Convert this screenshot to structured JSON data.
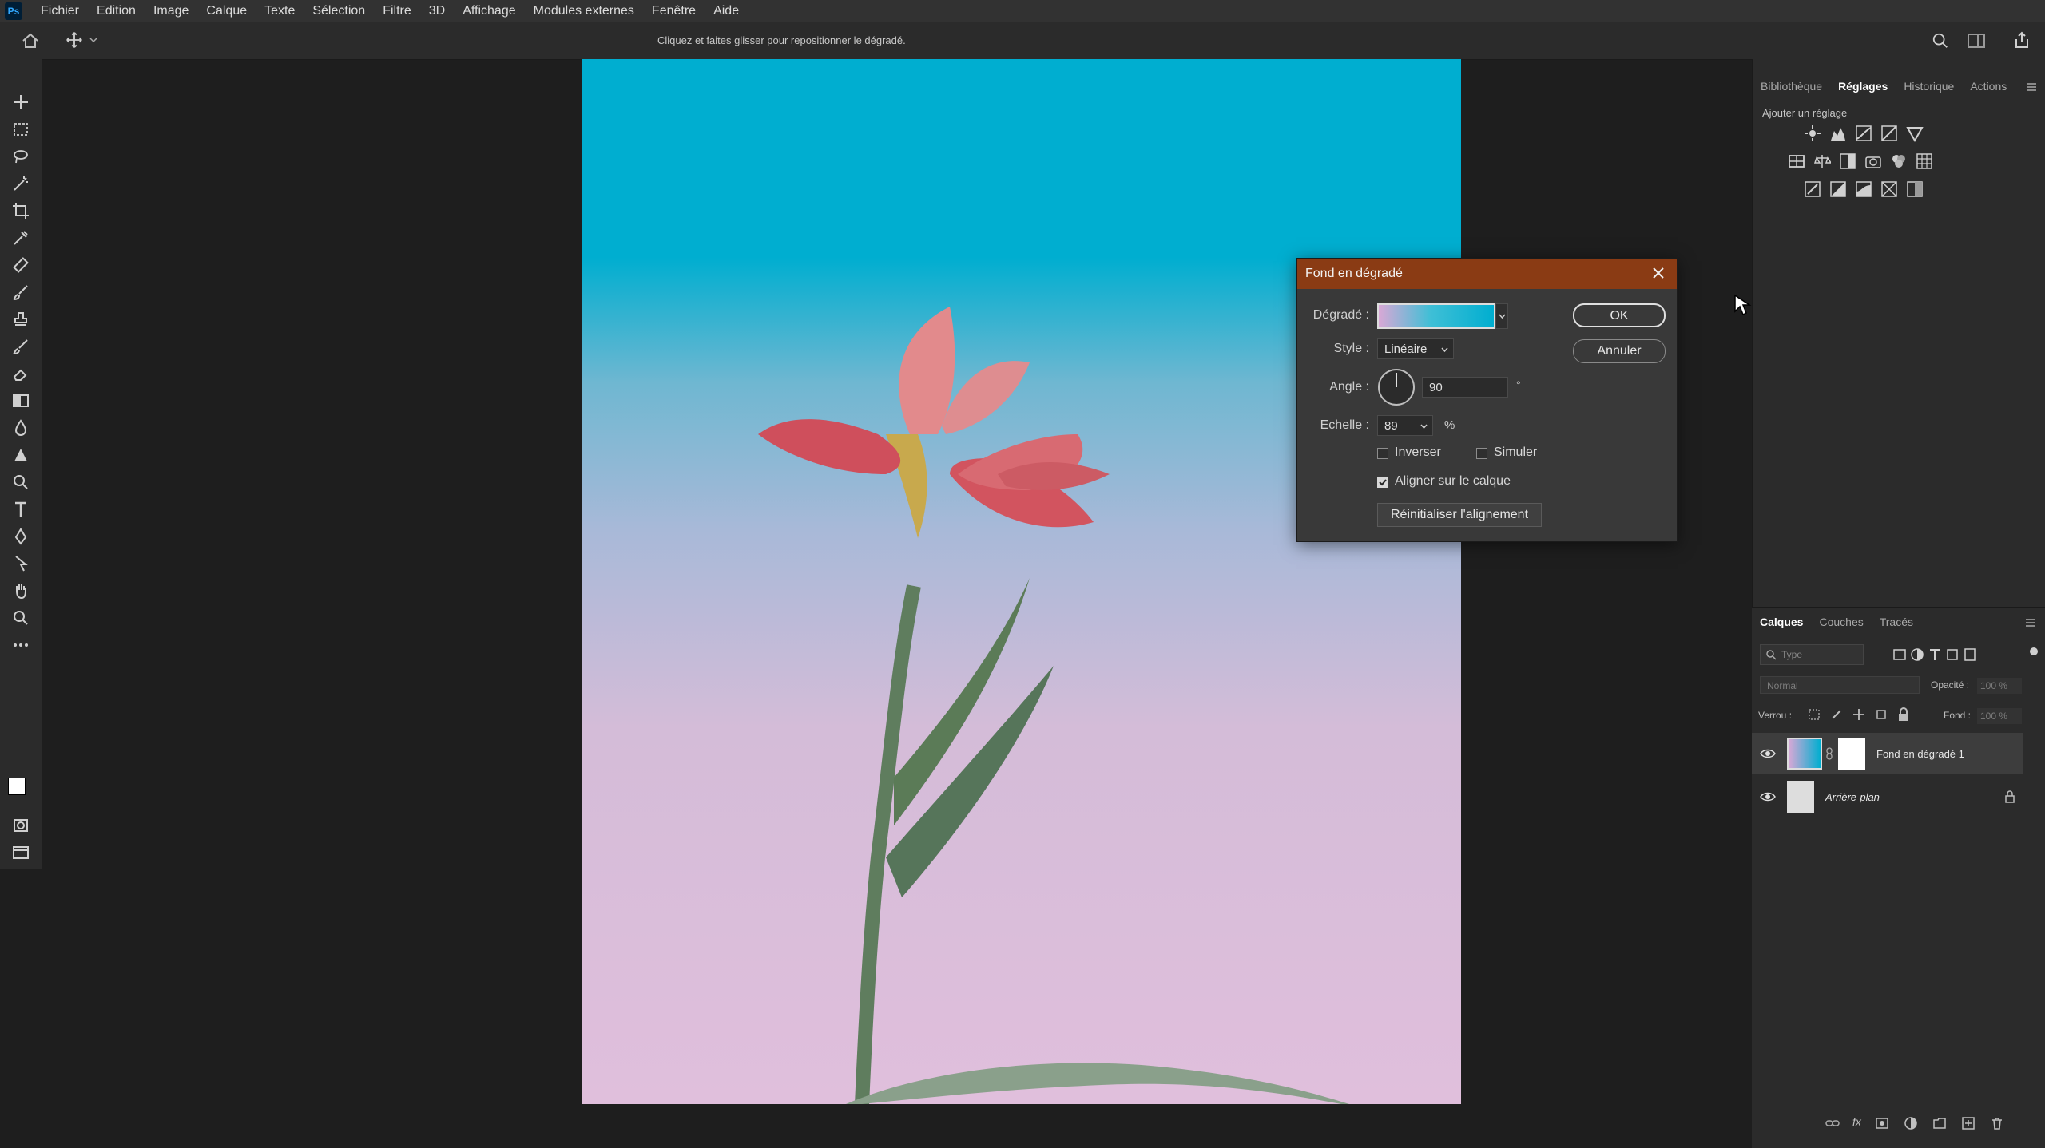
{
  "app": {
    "logo_text": "Ps"
  },
  "menu": [
    "Fichier",
    "Edition",
    "Image",
    "Calque",
    "Texte",
    "Sélection",
    "Filtre",
    "3D",
    "Affichage",
    "Modules externes",
    "Fenêtre",
    "Aide"
  ],
  "options_bar": {
    "hint": "Cliquez et faites glisser pour repositionner le dégradé."
  },
  "right_top_tabs": [
    "Bibliothèque",
    "Réglages",
    "Historique",
    "Actions"
  ],
  "adjustments": {
    "add_label": "Ajouter un réglage"
  },
  "layers_panel": {
    "tabs": [
      "Calques",
      "Couches",
      "Tracés"
    ],
    "filter_placeholder": "Type",
    "blend_mode": "Normal",
    "opacity_label": "Opacité :",
    "opacity_value": "100 %",
    "lock_label": "Verrou :",
    "fill_label": "Fond :",
    "fill_value": "100 %",
    "layers": [
      {
        "name": "Fond en dégradé 1",
        "selected": true
      },
      {
        "name": "Arrière-plan",
        "locked": true
      }
    ]
  },
  "dialog": {
    "title": "Fond en dégradé",
    "gradient_label": "Dégradé :",
    "style_label": "Style :",
    "style_value": "Linéaire",
    "angle_label": "Angle :",
    "angle_value": "90",
    "angle_unit": "°",
    "scale_label": "Echelle :",
    "scale_value": "89",
    "scale_unit": "%",
    "reverse_label": "Inverser",
    "reverse_checked": false,
    "dither_label": "Simuler",
    "dither_checked": false,
    "align_label": "Aligner sur le calque",
    "align_checked": true,
    "reset_button": "Réinitialiser l'alignement",
    "ok_button": "OK",
    "cancel_button": "Annuler"
  },
  "colors": {
    "accent_title": "#8a3b14",
    "gradient_start": "#d9a8d6",
    "gradient_end": "#00aed0"
  }
}
